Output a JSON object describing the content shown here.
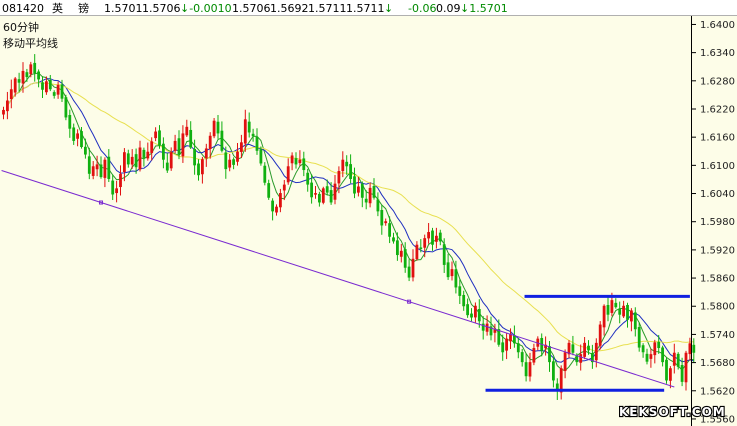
{
  "header": {
    "items": [
      {
        "text": "081420",
        "color": "#000000"
      },
      {
        "text": "英",
        "color": "#000000"
      },
      {
        "text": "镑",
        "color": "#000000"
      },
      {
        "text": "1.5701",
        "color": "#000000"
      },
      {
        "text": "1.5706",
        "color": "#000000"
      },
      {
        "text": "↓-0.0010",
        "color": "#008a00"
      },
      {
        "text": "1.5706",
        "color": "#000000"
      },
      {
        "text": "1.5692",
        "color": "#000000"
      },
      {
        "text": "1.5711",
        "color": "#000000"
      },
      {
        "text": "1.5711",
        "color": "#000000"
      },
      {
        "text": "↓",
        "color": "#008a00"
      },
      {
        "text": "-0.06",
        "color": "#008a00"
      },
      {
        "text": "0.09",
        "color": "#000000"
      },
      {
        "text": "↓1.5701",
        "color": "#008a00"
      }
    ]
  },
  "chart_labels": {
    "period": "60分钟",
    "indicator": "移动平均线"
  },
  "watermark": "KEKSOFT.COM",
  "colors": {
    "background": "#fdfde8",
    "up": "#e01010",
    "down": "#10b010",
    "ma_short": "#2a9a2a",
    "ma_mid": "#2030c0",
    "ma_long": "#e8e050",
    "trendline": "#7a2ad0",
    "support_resistance": "#1020e0",
    "axis": "#000000"
  },
  "chart_data": {
    "type": "candlestick",
    "y_ticks": [
      "1.6400",
      "1.6340",
      "1.6280",
      "1.6220",
      "1.6160",
      "1.6100",
      "1.6040",
      "1.5980",
      "1.5920",
      "1.5860",
      "1.5800",
      "1.5740",
      "1.5680",
      "1.5620",
      "1.5560"
    ],
    "ylim": [
      1.5545,
      1.6418
    ],
    "n_bars": 176,
    "close": [
      1.6218,
      1.6238,
      1.6262,
      1.6285,
      1.6276,
      1.6301,
      1.6288,
      1.6315,
      1.6296,
      1.6283,
      1.6261,
      1.6279,
      1.6262,
      1.6248,
      1.6271,
      1.6242,
      1.6202,
      1.6178,
      1.6152,
      1.6168,
      1.6139,
      1.6123,
      1.6082,
      1.6098,
      1.6102,
      1.6075,
      1.6112,
      1.6071,
      1.6038,
      1.6051,
      1.6082,
      1.6128,
      1.6102,
      1.6118,
      1.6096,
      1.6138,
      1.6116,
      1.6129,
      1.6151,
      1.6172,
      1.6142,
      1.6112,
      1.6089,
      1.6128,
      1.6152,
      1.6123,
      1.6168,
      1.6182,
      1.6138,
      1.61,
      1.6079,
      1.6113,
      1.6136,
      1.6163,
      1.6195,
      1.6168,
      1.6131,
      1.6092,
      1.6112,
      1.6101,
      1.6129,
      1.6149,
      1.6198,
      1.617,
      1.6162,
      1.6131,
      1.6104,
      1.6063,
      1.6031,
      1.6002,
      1.6012,
      1.6041,
      1.6059,
      1.6098,
      1.6121,
      1.6102,
      1.6112,
      1.609,
      1.6059,
      1.6032,
      1.6041,
      1.6021,
      1.6051,
      1.6042,
      1.6021,
      1.6061,
      1.6088,
      1.6112,
      1.6098,
      1.6071,
      1.604,
      1.6055,
      1.6031,
      1.6021,
      1.6052,
      1.6031,
      1.6002,
      1.5972,
      1.5981,
      1.5948,
      1.5938,
      1.5909,
      1.5918,
      1.5882,
      1.5861,
      1.5901,
      1.5931,
      1.5922,
      1.5945,
      1.5958,
      1.5931,
      1.595,
      1.5938,
      1.5888,
      1.5862,
      1.5879,
      1.584,
      1.5822,
      1.58,
      1.5781,
      1.5776,
      1.5801,
      1.5768,
      1.5748,
      1.5763,
      1.5738,
      1.5751,
      1.5718,
      1.5702,
      1.5731,
      1.5742,
      1.5721,
      1.5702,
      1.5681,
      1.5651,
      1.5681,
      1.5711,
      1.5731,
      1.5705,
      1.5718,
      1.5681,
      1.5642,
      1.5621,
      1.5668,
      1.5702,
      1.5722,
      1.5701,
      1.5681,
      1.5698,
      1.5722,
      1.5706,
      1.5681,
      1.5722,
      1.5761,
      1.5801,
      1.5782,
      1.5813,
      1.5798,
      1.5782,
      1.5801,
      1.5771,
      1.5791,
      1.5751,
      1.5712,
      1.5702,
      1.5682,
      1.5698,
      1.5723,
      1.5711,
      1.5681,
      1.5642,
      1.5668,
      1.5701,
      1.5671,
      1.5639,
      1.5701,
      1.5721,
      1.5701
    ],
    "lines": {
      "trendline": [
        [
          -0.5,
          1.6089
        ],
        [
          172.0,
          1.5628
        ]
      ],
      "resistance": [
        [
          133.6,
          1.5821
        ],
        [
          176.0,
          1.5821
        ]
      ],
      "support": [
        [
          123.6,
          1.5621
        ],
        [
          169.4,
          1.5621
        ]
      ]
    },
    "ma_periods": [
      5,
      10,
      30
    ],
    "grid": false,
    "legend": "none"
  }
}
